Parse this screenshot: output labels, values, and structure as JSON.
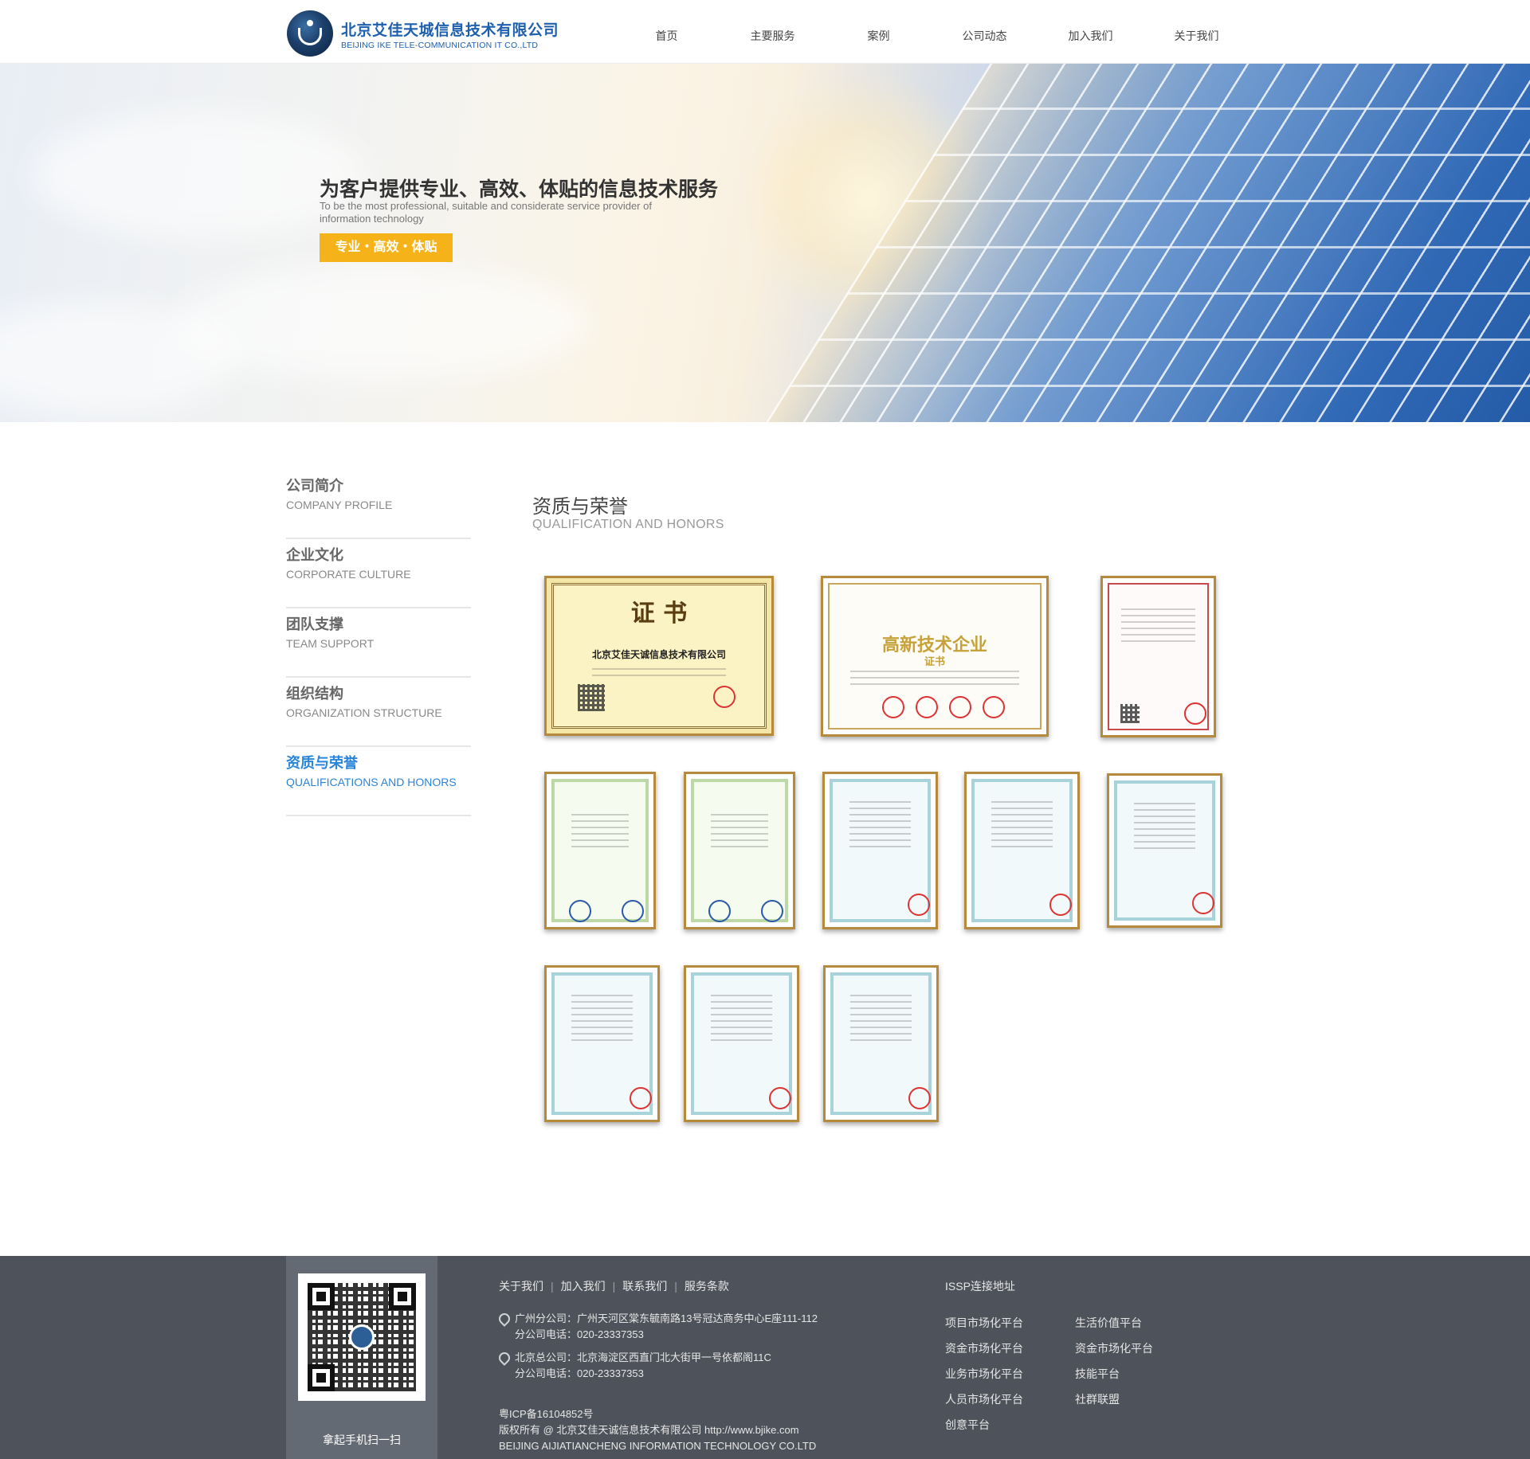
{
  "header": {
    "logo_cn": "北京艾佳天城信息技术有限公司",
    "logo_en": "BEIJING IKE TELE-COMMUNICATION IT CO.,LTD",
    "nav": [
      "首页",
      "主要服务",
      "案例",
      "公司动态",
      "加入我们",
      "关于我们"
    ]
  },
  "banner": {
    "title": "为客户提供专业、高效、体贴的信息技术服务",
    "subtitle": "To be the most professional, suitable and considerate service provider of information technology",
    "button": "专业・高效・体贴"
  },
  "sidebar": {
    "items": [
      {
        "cn": "公司简介",
        "en": "COMPANY PROFILE"
      },
      {
        "cn": "企业文化",
        "en": "CORPORATE CULTURE"
      },
      {
        "cn": "团队支撑",
        "en": "TEAM SUPPORT"
      },
      {
        "cn": "组织结构",
        "en": "ORGANIZATION STRUCTURE"
      },
      {
        "cn": "资质与荣誉",
        "en": "QUALIFICATIONS AND HONORS"
      }
    ],
    "active_index": 4
  },
  "content": {
    "title": "资质与荣誉",
    "subtitle": "QUALIFICATION AND HONORS",
    "certificates": {
      "equity": {
        "heading": "证 书",
        "company": "北京艾佳天诚信息技术有限公司"
      },
      "hightech": {
        "heading": "高新技术企业",
        "sub": "证书"
      }
    }
  },
  "footer": {
    "qr_caption": "拿起手机扫一扫",
    "links": [
      "关于我们",
      "加入我们",
      "联系我们",
      "服务条款"
    ],
    "addresses": [
      {
        "line1": "广州分公司：广州天河区棠东毓南路13号冠达商务中心E座111-112",
        "line2": "分公司电话：020-23337353"
      },
      {
        "line1": "北京总公司：北京海淀区西直门北大街甲一号依都阁11C",
        "line2": "分公司电话：020-23337353"
      }
    ],
    "icp": "粤ICP备16104852号",
    "copyright": "版权所有 @ 北京艾佳天诚信息技术有限公司 http://www.bjike.com",
    "company_en": "BEIJING AIJIATIANCHENG INFORMATION TECHNOLOGY CO.LTD",
    "issp_title": "ISSP连接地址",
    "issp_col1": [
      "项目市场化平台",
      "资金市场化平台",
      "业务市场化平台",
      "人员市场化平台",
      "创意平台"
    ],
    "issp_col2": [
      "生活价值平台",
      "资金市场化平台",
      "技能平台",
      "社群联盟"
    ]
  }
}
